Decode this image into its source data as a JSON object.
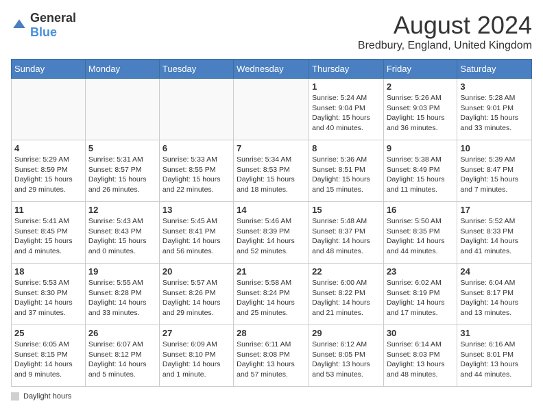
{
  "header": {
    "logo_general": "General",
    "logo_blue": "Blue",
    "month": "August 2024",
    "location": "Bredbury, England, United Kingdom"
  },
  "days_of_week": [
    "Sunday",
    "Monday",
    "Tuesday",
    "Wednesday",
    "Thursday",
    "Friday",
    "Saturday"
  ],
  "weeks": [
    [
      {
        "day": "",
        "info": ""
      },
      {
        "day": "",
        "info": ""
      },
      {
        "day": "",
        "info": ""
      },
      {
        "day": "",
        "info": ""
      },
      {
        "day": "1",
        "info": "Sunrise: 5:24 AM\nSunset: 9:04 PM\nDaylight: 15 hours\nand 40 minutes."
      },
      {
        "day": "2",
        "info": "Sunrise: 5:26 AM\nSunset: 9:03 PM\nDaylight: 15 hours\nand 36 minutes."
      },
      {
        "day": "3",
        "info": "Sunrise: 5:28 AM\nSunset: 9:01 PM\nDaylight: 15 hours\nand 33 minutes."
      }
    ],
    [
      {
        "day": "4",
        "info": "Sunrise: 5:29 AM\nSunset: 8:59 PM\nDaylight: 15 hours\nand 29 minutes."
      },
      {
        "day": "5",
        "info": "Sunrise: 5:31 AM\nSunset: 8:57 PM\nDaylight: 15 hours\nand 26 minutes."
      },
      {
        "day": "6",
        "info": "Sunrise: 5:33 AM\nSunset: 8:55 PM\nDaylight: 15 hours\nand 22 minutes."
      },
      {
        "day": "7",
        "info": "Sunrise: 5:34 AM\nSunset: 8:53 PM\nDaylight: 15 hours\nand 18 minutes."
      },
      {
        "day": "8",
        "info": "Sunrise: 5:36 AM\nSunset: 8:51 PM\nDaylight: 15 hours\nand 15 minutes."
      },
      {
        "day": "9",
        "info": "Sunrise: 5:38 AM\nSunset: 8:49 PM\nDaylight: 15 hours\nand 11 minutes."
      },
      {
        "day": "10",
        "info": "Sunrise: 5:39 AM\nSunset: 8:47 PM\nDaylight: 15 hours\nand 7 minutes."
      }
    ],
    [
      {
        "day": "11",
        "info": "Sunrise: 5:41 AM\nSunset: 8:45 PM\nDaylight: 15 hours\nand 4 minutes."
      },
      {
        "day": "12",
        "info": "Sunrise: 5:43 AM\nSunset: 8:43 PM\nDaylight: 15 hours\nand 0 minutes."
      },
      {
        "day": "13",
        "info": "Sunrise: 5:45 AM\nSunset: 8:41 PM\nDaylight: 14 hours\nand 56 minutes."
      },
      {
        "day": "14",
        "info": "Sunrise: 5:46 AM\nSunset: 8:39 PM\nDaylight: 14 hours\nand 52 minutes."
      },
      {
        "day": "15",
        "info": "Sunrise: 5:48 AM\nSunset: 8:37 PM\nDaylight: 14 hours\nand 48 minutes."
      },
      {
        "day": "16",
        "info": "Sunrise: 5:50 AM\nSunset: 8:35 PM\nDaylight: 14 hours\nand 44 minutes."
      },
      {
        "day": "17",
        "info": "Sunrise: 5:52 AM\nSunset: 8:33 PM\nDaylight: 14 hours\nand 41 minutes."
      }
    ],
    [
      {
        "day": "18",
        "info": "Sunrise: 5:53 AM\nSunset: 8:30 PM\nDaylight: 14 hours\nand 37 minutes."
      },
      {
        "day": "19",
        "info": "Sunrise: 5:55 AM\nSunset: 8:28 PM\nDaylight: 14 hours\nand 33 minutes."
      },
      {
        "day": "20",
        "info": "Sunrise: 5:57 AM\nSunset: 8:26 PM\nDaylight: 14 hours\nand 29 minutes."
      },
      {
        "day": "21",
        "info": "Sunrise: 5:58 AM\nSunset: 8:24 PM\nDaylight: 14 hours\nand 25 minutes."
      },
      {
        "day": "22",
        "info": "Sunrise: 6:00 AM\nSunset: 8:22 PM\nDaylight: 14 hours\nand 21 minutes."
      },
      {
        "day": "23",
        "info": "Sunrise: 6:02 AM\nSunset: 8:19 PM\nDaylight: 14 hours\nand 17 minutes."
      },
      {
        "day": "24",
        "info": "Sunrise: 6:04 AM\nSunset: 8:17 PM\nDaylight: 14 hours\nand 13 minutes."
      }
    ],
    [
      {
        "day": "25",
        "info": "Sunrise: 6:05 AM\nSunset: 8:15 PM\nDaylight: 14 hours\nand 9 minutes."
      },
      {
        "day": "26",
        "info": "Sunrise: 6:07 AM\nSunset: 8:12 PM\nDaylight: 14 hours\nand 5 minutes."
      },
      {
        "day": "27",
        "info": "Sunrise: 6:09 AM\nSunset: 8:10 PM\nDaylight: 14 hours\nand 1 minute."
      },
      {
        "day": "28",
        "info": "Sunrise: 6:11 AM\nSunset: 8:08 PM\nDaylight: 13 hours\nand 57 minutes."
      },
      {
        "day": "29",
        "info": "Sunrise: 6:12 AM\nSunset: 8:05 PM\nDaylight: 13 hours\nand 53 minutes."
      },
      {
        "day": "30",
        "info": "Sunrise: 6:14 AM\nSunset: 8:03 PM\nDaylight: 13 hours\nand 48 minutes."
      },
      {
        "day": "31",
        "info": "Sunrise: 6:16 AM\nSunset: 8:01 PM\nDaylight: 13 hours\nand 44 minutes."
      }
    ]
  ],
  "footer": {
    "daylight_label": "Daylight hours"
  }
}
